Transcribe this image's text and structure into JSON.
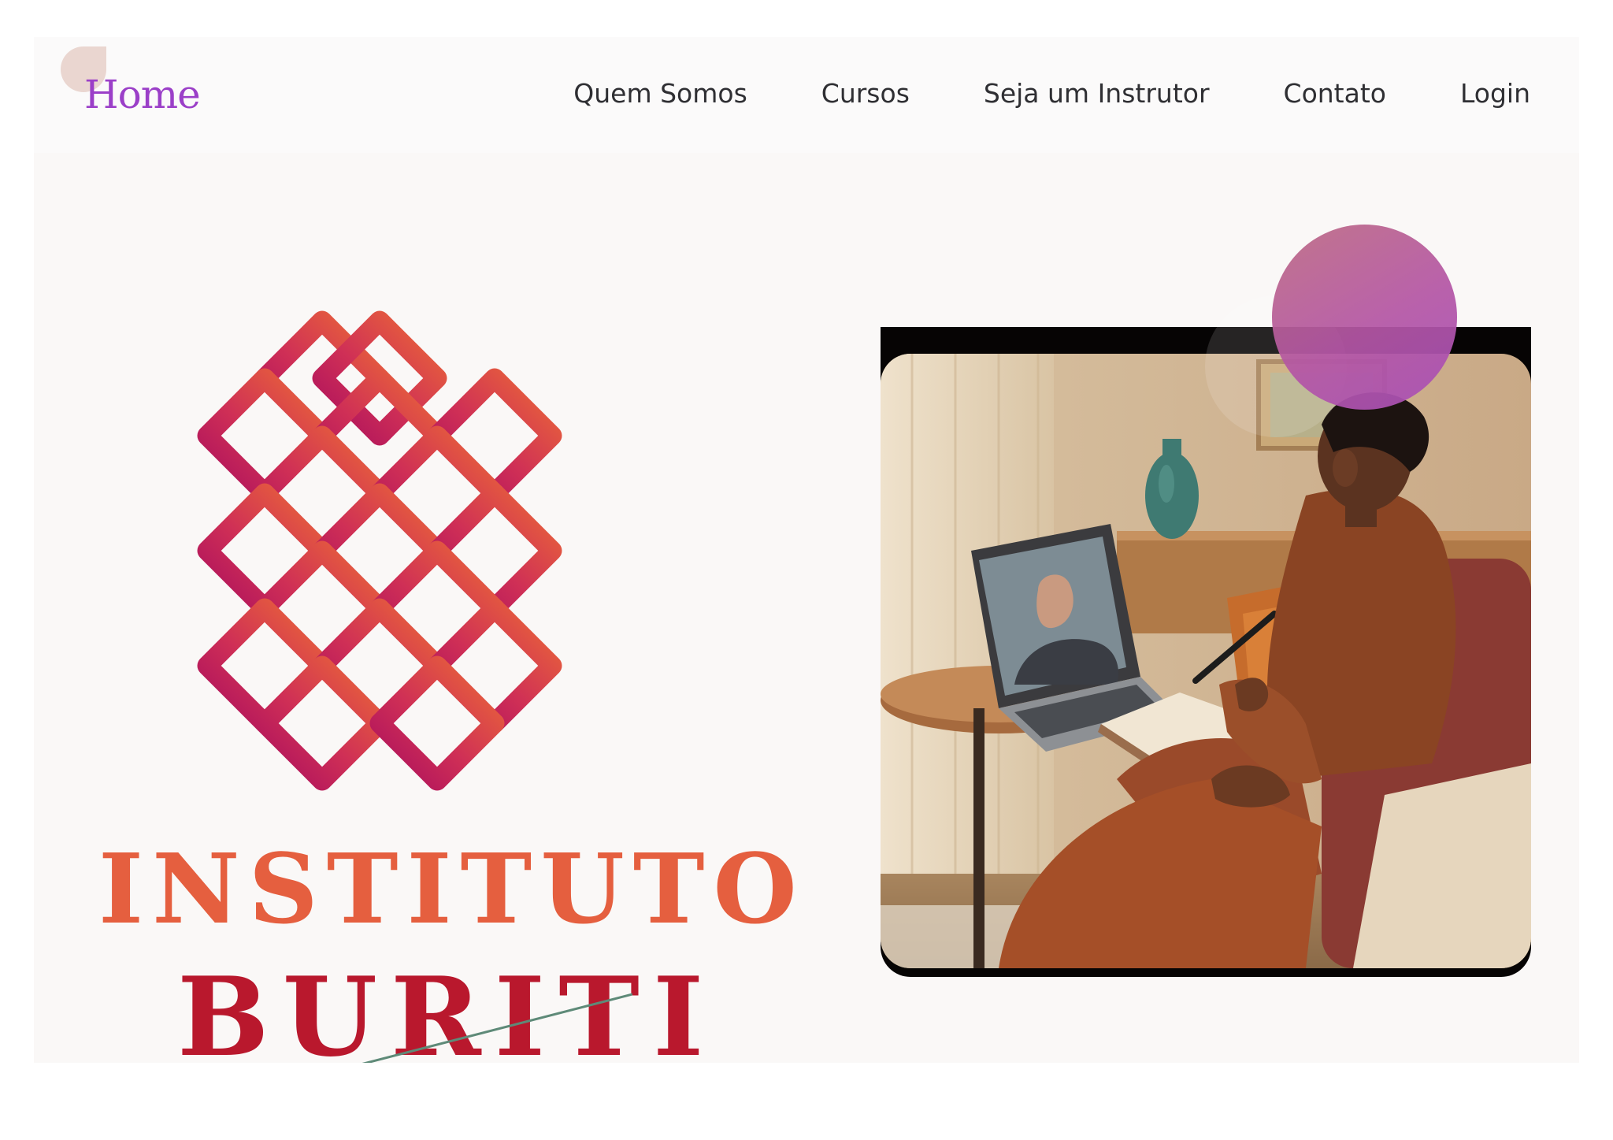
{
  "nav": {
    "brand": "Home",
    "links": [
      "Quem Somos",
      "Cursos",
      "Seja um Instrutor",
      "Contato",
      "Login"
    ]
  },
  "hero": {
    "brand_line_1": "INSTITUTO",
    "brand_line_2": "BURITI"
  },
  "colors": {
    "brand_purple": "#9b3fc8",
    "logo_orange": "#ec6a36",
    "logo_magenta": "#aa0e5e",
    "word_orange": "#e55f3f",
    "word_red": "#b9182d",
    "bubble": "#b456a5"
  },
  "icons": {
    "logo": "lattice-diamond-logo",
    "bubble": "decorative-circle"
  }
}
